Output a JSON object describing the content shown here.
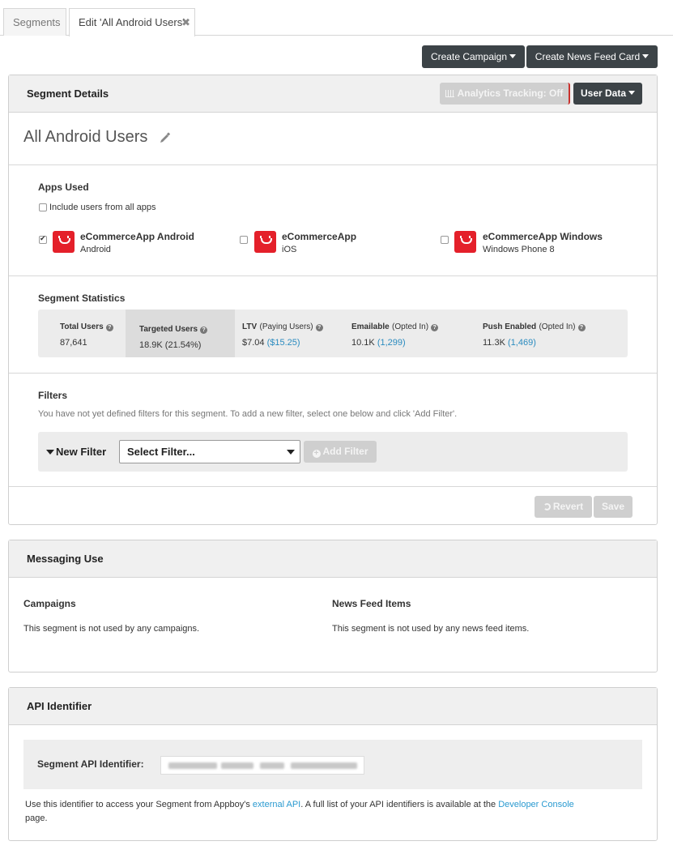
{
  "tabs": {
    "segments_label": "Segments",
    "edit_label": "Edit 'All Android Users'",
    "close_glyph": "✖"
  },
  "top_actions": {
    "create_campaign": "Create Campaign",
    "create_news_feed_card": "Create News Feed Card"
  },
  "segment_details": {
    "header": "Segment Details",
    "analytics_tracking": "Analytics Tracking: Off",
    "user_data": "User Data",
    "segment_name": "All Android Users",
    "apps_used": {
      "title": "Apps Used",
      "include_all_label": "Include users from all apps",
      "include_all_checked": false,
      "apps": [
        {
          "name": "eCommerceApp Android",
          "platform": "Android",
          "checked": true
        },
        {
          "name": "eCommerceApp",
          "platform": "iOS",
          "checked": false
        },
        {
          "name": "eCommerceApp Windows",
          "platform": "Windows Phone 8",
          "checked": false
        }
      ]
    },
    "statistics": {
      "title": "Segment Statistics",
      "total_users_label": "Total Users",
      "total_users_value": "87,641",
      "targeted_users_label": "Targeted Users",
      "targeted_users_value": "18.9K (21.54%)",
      "ltv_label": "LTV",
      "ltv_sub_label": "(Paying Users)",
      "ltv_value": "$7.04",
      "ltv_sub_value": "($15.25)",
      "emailable_label": "Emailable",
      "emailable_sub_label": "(Opted In)",
      "emailable_value": "10.1K",
      "emailable_sub_value": "(1,299)",
      "push_label": "Push Enabled",
      "push_sub_label": "(Opted In)",
      "push_value": "11.3K",
      "push_sub_value": "(1,469)"
    },
    "filters": {
      "title": "Filters",
      "description": "You have not yet defined filters for this segment. To add a new filter, select one below and click 'Add Filter'.",
      "new_filter_label": "New Filter",
      "select_placeholder": "Select Filter...",
      "add_filter": "Add Filter"
    },
    "revert": "Revert",
    "save": "Save"
  },
  "messaging_use": {
    "header": "Messaging Use",
    "campaigns_title": "Campaigns",
    "campaigns_text": "This segment is not used by any campaigns.",
    "news_feed_title": "News Feed Items",
    "news_feed_text": "This segment is not used by any news feed items."
  },
  "api_identifier": {
    "header": "API Identifier",
    "label": "Segment API Identifier:",
    "note_prefix": "Use this identifier to access your Segment from Appboy's ",
    "external_api_link": "external API",
    "note_middle": ". A full list of your API identifiers is available at the ",
    "developer_console_link": "Developer Console",
    "note_suffix": "page."
  },
  "colors": {
    "dark_button": "#3c4347",
    "accent_link": "#2a9ad0",
    "app_icon": "#e4202a",
    "analytics_border": "#c9302c"
  },
  "icons": [
    "close-icon",
    "caret-down-icon",
    "bar-chart-icon",
    "pencil-icon",
    "app-logo-icon",
    "help-icon",
    "filter-icon",
    "plus-circle-icon",
    "undo-icon"
  ]
}
